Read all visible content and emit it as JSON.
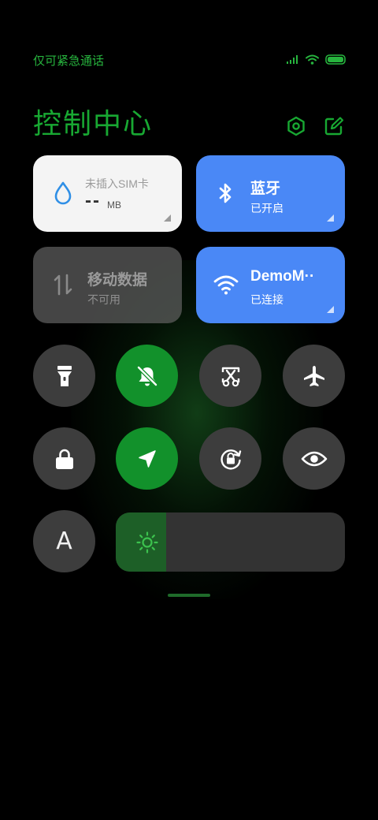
{
  "status_bar": {
    "carrier_text": "仅可紧急通话"
  },
  "header": {
    "title": "控制中心"
  },
  "tiles": {
    "data_usage": {
      "label": "未插入SIM卡",
      "value": "--",
      "unit": "MB"
    },
    "bluetooth": {
      "title": "蓝牙",
      "status": "已开启"
    },
    "mobile_data": {
      "title": "移动数据",
      "status": "不可用"
    },
    "wifi": {
      "title": "DemoM··",
      "status": "已连接"
    }
  },
  "toggles": [
    {
      "name": "flashlight",
      "active": false
    },
    {
      "name": "silent",
      "active": true
    },
    {
      "name": "screenshot",
      "active": false
    },
    {
      "name": "airplane-mode",
      "active": false
    },
    {
      "name": "lock-screen",
      "active": false
    },
    {
      "name": "location",
      "active": true
    },
    {
      "name": "auto-rotate",
      "active": false
    },
    {
      "name": "reading-mode",
      "active": false
    },
    {
      "name": "auto-brightness",
      "active": false,
      "label": "A"
    }
  ],
  "brightness": {
    "level": 0.22
  },
  "colors": {
    "accent_green": "#18a832",
    "active_green": "#12912b",
    "tile_blue": "#4a88f6",
    "button_gray": "#3d3d3d"
  }
}
